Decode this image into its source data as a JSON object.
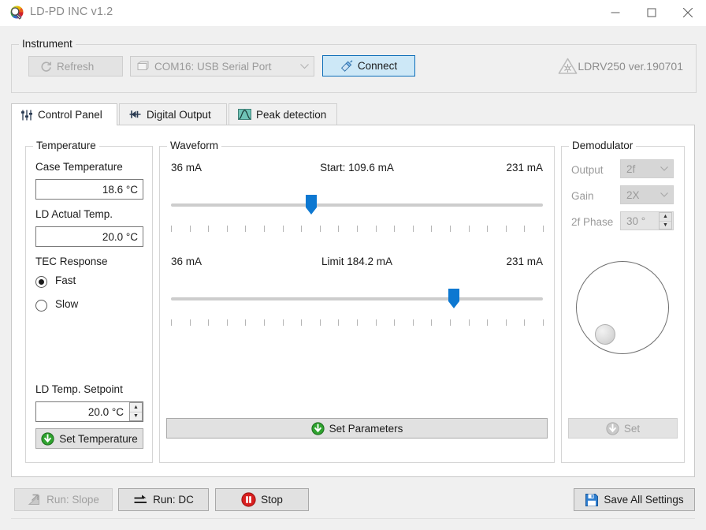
{
  "window": {
    "title": "LD-PD INC v1.2",
    "icon": "app-logo-icon",
    "minimize": "minimize-icon",
    "maximize": "maximize-icon",
    "close": "close-icon"
  },
  "instrument": {
    "group_label": "Instrument",
    "refresh_label": "Refresh",
    "refresh_enabled": false,
    "com_port_value": "COM16: USB Serial Port",
    "connect_label": "Connect",
    "device_label": "LDRV250 ver.190701"
  },
  "tabs": [
    {
      "label": "Control Panel",
      "icon": "sliders-icon",
      "active": true
    },
    {
      "label": "Digital Output",
      "icon": "digital-pin-icon",
      "active": false
    },
    {
      "label": "Peak detection",
      "icon": "peak-curve-icon",
      "active": false
    }
  ],
  "temperature": {
    "group_label": "Temperature",
    "case_temp_label": "Case Temperature",
    "case_temp_value": "18.6 °C",
    "ld_actual_label": "LD Actual Temp.",
    "ld_actual_value": "20.0 °C",
    "tec_response_label": "TEC Response",
    "tec_options": [
      {
        "label": "Fast",
        "selected": true
      },
      {
        "label": "Slow",
        "selected": false
      }
    ],
    "setpoint_label": "LD Temp. Setpoint",
    "setpoint_value": "20.0 °C",
    "set_temperature_label": "Set Temperature"
  },
  "waveform": {
    "group_label": "Waveform",
    "set_parameters_label": "Set Parameters",
    "sliders": [
      {
        "name": "start",
        "min_label": "36 mA",
        "max_label": "231 mA",
        "center_label": "Start:  109.6 mA",
        "min": 36,
        "max": 231,
        "value": 109.6,
        "tick_count": 20
      },
      {
        "name": "limit",
        "min_label": "36 mA",
        "max_label": "231 mA",
        "center_label": "Limit  184.2 mA",
        "min": 36,
        "max": 231,
        "value": 184.2,
        "tick_count": 20
      }
    ]
  },
  "demodulator": {
    "group_label": "Demodulator",
    "enabled": false,
    "output_label": "Output",
    "output_value": "2f",
    "gain_label": "Gain",
    "gain_value": "2X",
    "phase_label": "2f Phase",
    "phase_value": "30 °",
    "knob_angle_deg": 215,
    "set_label": "Set"
  },
  "footer": {
    "run_slope_label": "Run: Slope",
    "run_slope_enabled": false,
    "run_dc_label": "Run: DC",
    "stop_label": "Stop",
    "save_all_label": "Save All Settings"
  },
  "colors": {
    "accent_blue": "#0d78d1",
    "window_bg": "#f0f0f0",
    "panel_bg": "#ffffff",
    "green": "#2aa02a",
    "red": "#d41e1e",
    "teal": "#5fbfb0",
    "disabled_text": "#a0a0a0"
  }
}
